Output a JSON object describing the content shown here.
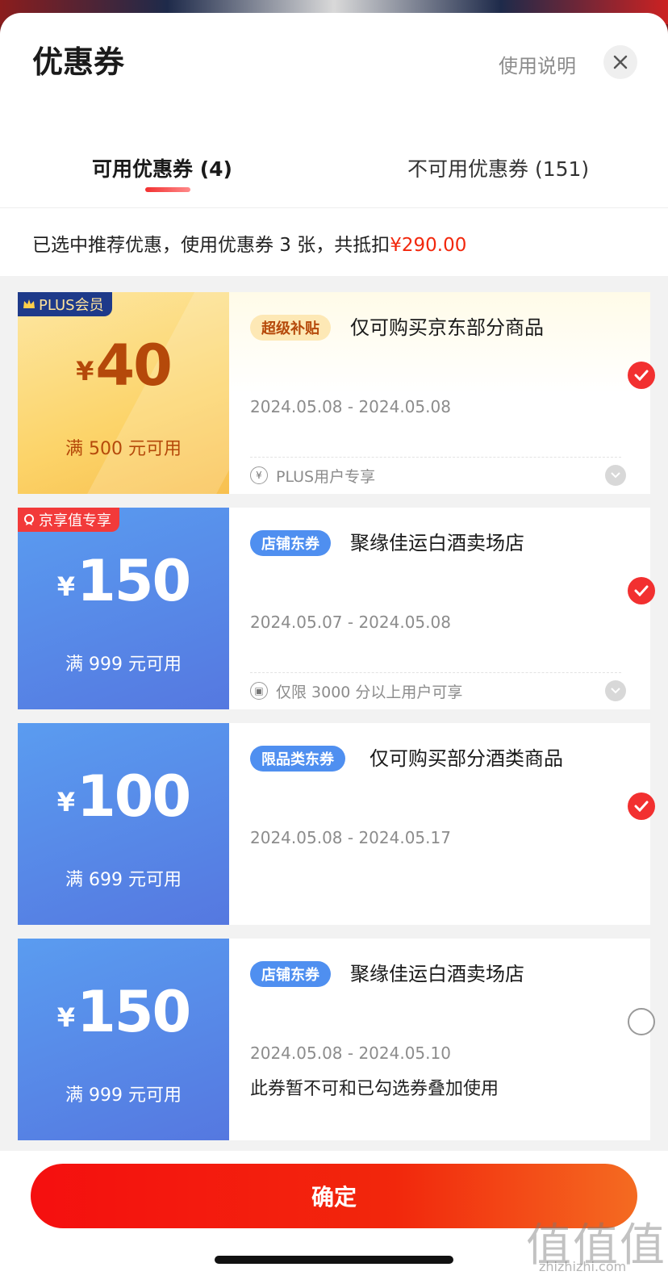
{
  "header": {
    "title": "优惠券",
    "help_link": "使用说明"
  },
  "tabs": [
    {
      "label": "可用优惠券 (4)"
    },
    {
      "label": "不可用优惠券 (151)"
    }
  ],
  "summary": {
    "text": "已选中推荐优惠，使用优惠券 3 张，共抵扣",
    "amount": "¥290.00"
  },
  "coupons": [
    {
      "badge": "PLUS会员",
      "currency": "¥",
      "amount": "40",
      "condition": "满 500 元可用",
      "tag": "超级补贴",
      "title": "仅可购买京东部分商品",
      "dates": "2024.05.08 - 2024.05.08",
      "footer": "PLUS用户专享",
      "selected": true
    },
    {
      "badge": "京享值专享",
      "currency": "¥",
      "amount": "150",
      "condition": "满 999 元可用",
      "tag": "店铺东券",
      "title": "聚缘佳运白酒卖场店",
      "dates": "2024.05.07 - 2024.05.08",
      "footer": "仅限 3000 分以上用户可享",
      "selected": true
    },
    {
      "currency": "¥",
      "amount": "100",
      "condition": "满 699 元可用",
      "tag": "限品类东券",
      "title": "仅可购买部分酒类商品",
      "dates": "2024.05.08 - 2024.05.17",
      "selected": true
    },
    {
      "currency": "¥",
      "amount": "150",
      "condition": "满 999 元可用",
      "tag": "店铺东券",
      "title": "聚缘佳运白酒卖场店",
      "dates": "2024.05.08 - 2024.05.10",
      "note": "此券暂不可和已勾选券叠加使用",
      "selected": false
    }
  ],
  "footer": {
    "confirm_label": "确定"
  },
  "watermark": {
    "text": "值值值",
    "url": "zhizhizhi.com"
  },
  "colors": {
    "accent_red": "#f2270c",
    "coupon_blue": "#5578e0",
    "coupon_gold": "#fcd46a"
  }
}
